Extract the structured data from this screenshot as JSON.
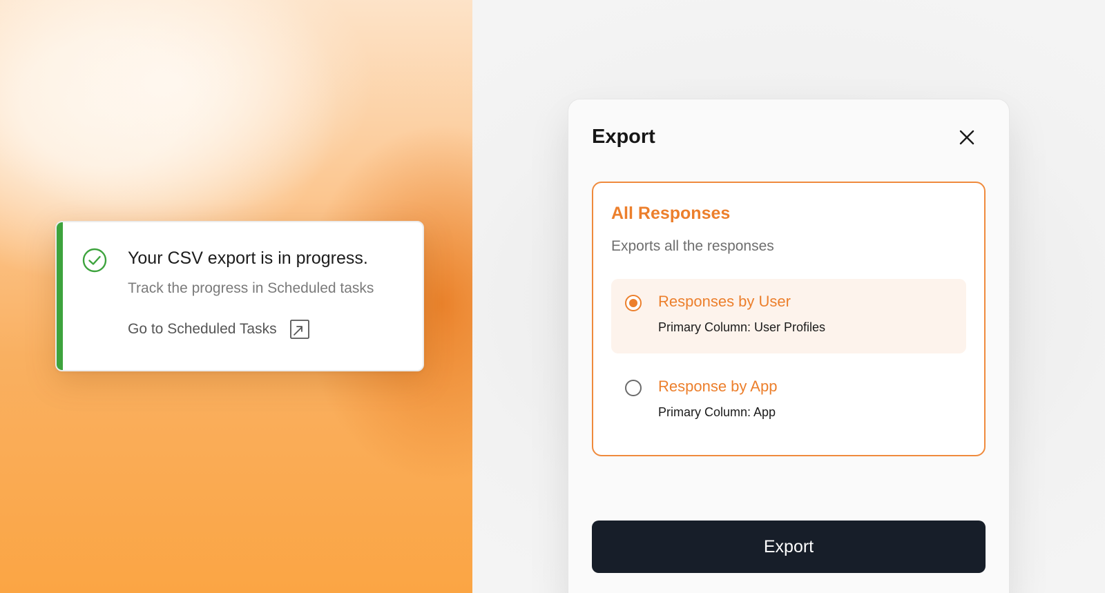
{
  "toast": {
    "title": "Your CSV export is in progress.",
    "subtitle": "Track the progress in Scheduled tasks",
    "link_label": "Go to Scheduled Tasks",
    "status_icon": "check-circle-icon",
    "link_icon": "external-link-icon"
  },
  "modal": {
    "title": "Export",
    "close_icon": "close-icon",
    "option_group": {
      "title": "All Responses",
      "subtitle": "Exports all the responses",
      "options": [
        {
          "label": "Responses by User",
          "description": "Primary Column: User Profiles",
          "selected": true
        },
        {
          "label": "Response by App",
          "description": "Primary Column: App",
          "selected": false
        }
      ]
    },
    "export_button_label": "Export"
  },
  "colors": {
    "accent_orange": "#ec7f2c",
    "success_green": "#3da33d",
    "button_dark": "#171e29"
  }
}
